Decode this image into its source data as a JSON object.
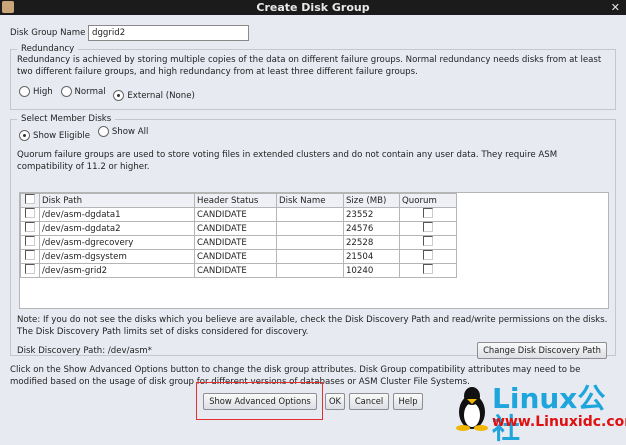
{
  "window": {
    "title": "Create Disk Group"
  },
  "disk_group_name": {
    "label": "Disk Group Name",
    "value": "dggrid2"
  },
  "redundancy": {
    "legend": "Redundancy",
    "description": "Redundancy is achieved by storing multiple copies of the data on different failure groups. Normal redundancy needs disks from at least two different failure groups, and high redundancy from at least three different failure groups.",
    "options": [
      "High",
      "Normal",
      "External (None)"
    ],
    "selected": "External (None)"
  },
  "member_disks": {
    "legend": "Select Member Disks",
    "show_options": [
      "Show Eligible",
      "Show All"
    ],
    "selected": "Show Eligible",
    "quorum_note": "Quorum failure groups are used to store voting files in extended clusters and do not contain any user data. They require ASM compatibility of 11.2 or higher.",
    "columns": [
      "Disk Path",
      "Header Status",
      "Disk Name",
      "Size (MB)",
      "Quorum"
    ],
    "rows": [
      {
        "path": "/dev/asm-dgdata1",
        "status": "CANDIDATE",
        "name": "",
        "size": "23552"
      },
      {
        "path": "/dev/asm-dgdata2",
        "status": "CANDIDATE",
        "name": "",
        "size": "24576"
      },
      {
        "path": "/dev/asm-dgrecovery",
        "status": "CANDIDATE",
        "name": "",
        "size": "22528"
      },
      {
        "path": "/dev/asm-dgsystem",
        "status": "CANDIDATE",
        "name": "",
        "size": "21504"
      },
      {
        "path": "/dev/asm-grid2",
        "status": "CANDIDATE",
        "name": "",
        "size": "10240"
      }
    ],
    "discovery_note": "Note: If you do not see the disks which you believe are available, check the Disk Discovery Path and read/write permissions on the disks. The Disk Discovery Path limits set of disks considered for discovery.",
    "discovery_path": "Disk Discovery Path: /dev/asm*",
    "change_path_button": "Change Disk Discovery Path"
  },
  "footer_note": "Click on the Show Advanced Options button to change the disk group attributes. Disk Group compatibility attributes may need to be modified based on the usage of disk group for different versions of databases or ASM Cluster File Systems.",
  "buttons": {
    "advanced": "Show Advanced Options",
    "ok": "OK",
    "cancel": "Cancel",
    "help": "Help"
  },
  "watermark": {
    "brand": "Linux公社",
    "url": "www.Linuxidc.com"
  }
}
